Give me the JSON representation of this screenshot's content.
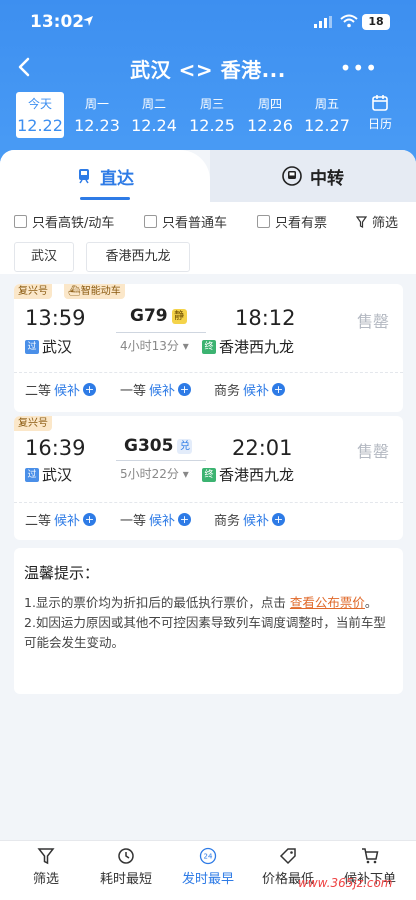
{
  "status": {
    "time": "13:02",
    "battery": "18"
  },
  "nav": {
    "title": "武汉 <> 香港...",
    "more": "•••"
  },
  "dates": [
    {
      "dow": "今天",
      "date": "12.22",
      "active": true
    },
    {
      "dow": "周一",
      "date": "12.23"
    },
    {
      "dow": "周二",
      "date": "12.24"
    },
    {
      "dow": "周三",
      "date": "12.25"
    },
    {
      "dow": "周四",
      "date": "12.26"
    },
    {
      "dow": "周五",
      "date": "12.27"
    }
  ],
  "calendar_label": "日历",
  "tabs": {
    "direct": "直达",
    "transfer": "中转"
  },
  "filters": [
    "只看高铁/动车",
    "只看普通车",
    "只看有票",
    "筛选"
  ],
  "station_chips": [
    "武汉",
    "香港西九龙"
  ],
  "trains": [
    {
      "tags": [
        "复兴号",
        "智能动车"
      ],
      "dep_time": "13:59",
      "train_no": "G79",
      "badge": "静",
      "arr_time": "18:12",
      "duration": "4小时13分",
      "from_badge": "过",
      "from": "武汉",
      "to_badge": "终",
      "to": "香港西九龙",
      "status": "售罄",
      "seats": [
        {
          "name": "二等",
          "state": "候补"
        },
        {
          "name": "一等",
          "state": "候补"
        },
        {
          "name": "商务",
          "state": "候补"
        }
      ]
    },
    {
      "tags": [
        "复兴号"
      ],
      "dep_time": "16:39",
      "train_no": "G305",
      "badge": "兑",
      "arr_time": "22:01",
      "duration": "5小时22分",
      "from_badge": "过",
      "from": "武汉",
      "to_badge": "终",
      "to": "香港西九龙",
      "status": "售罄",
      "seats": [
        {
          "name": "二等",
          "state": "候补"
        },
        {
          "name": "一等",
          "state": "候补"
        },
        {
          "name": "商务",
          "state": "候补"
        }
      ]
    }
  ],
  "notice": {
    "title": "温馨提示：",
    "line1_prefix": "1.显示的票价均为折扣后的最低执行票价，点击 ",
    "line1_link": "查看公布票价",
    "line1_suffix": "。",
    "line2": "2.如因运力原因或其他不可控因素导致列车调度调整时，当前车型可能会发生变动。"
  },
  "bottom_bar": [
    {
      "label": "筛选",
      "icon": "filter-icon"
    },
    {
      "label": "耗时最短",
      "icon": "clock-icon"
    },
    {
      "label": "发时最早",
      "icon": "24h-icon",
      "active": true
    },
    {
      "label": "价格最低",
      "icon": "price-tag-icon"
    },
    {
      "label": "候补下单",
      "icon": "cart-icon"
    }
  ],
  "watermark": "www.365jz.com",
  "colors": {
    "primary": "#3d8ff0",
    "accent": "#2e7be6",
    "link": "#e06a2b"
  }
}
